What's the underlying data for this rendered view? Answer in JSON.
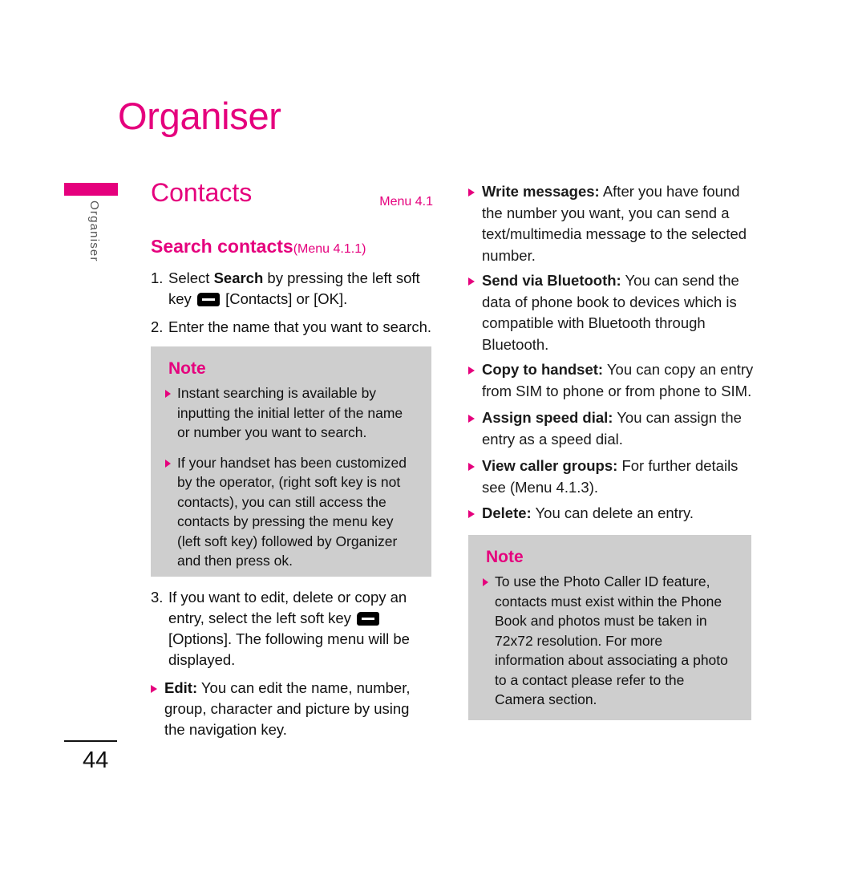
{
  "colors": {
    "accent": "#E5007D",
    "note_background": "#CECECE",
    "text": "#111111",
    "side_tab_text": "#555555"
  },
  "chapter": {
    "title": "Organiser",
    "side_tab_label": "Organiser"
  },
  "section": {
    "title": "Contacts",
    "menu_ref": "Menu 4.1"
  },
  "subsection": {
    "title": "Search contacts",
    "menu_ref": "(Menu 4.1.1)"
  },
  "left_column": {
    "steps": [
      {
        "number": "1.",
        "parts": [
          {
            "type": "text",
            "value": "Select "
          },
          {
            "type": "bold",
            "value": "Search"
          },
          {
            "type": "text",
            "value": " by pressing the left soft key "
          },
          {
            "type": "icon",
            "value": "soft-key-icon"
          },
          {
            "type": "text",
            "value": " [Contacts] or [OK]."
          }
        ],
        "plain": "1. Select Search by pressing the left soft key [Contacts] or [OK]."
      },
      {
        "number": "2.",
        "parts": [
          {
            "type": "text",
            "value": "Enter the name that you want to search."
          }
        ],
        "plain": "2. Enter the name that you want to search."
      },
      {
        "number": "3.",
        "parts": [
          {
            "type": "text",
            "value": "If you want to edit, delete or copy an entry, select the left soft key "
          },
          {
            "type": "icon",
            "value": "soft-key-icon"
          },
          {
            "type": "text",
            "value": " [Options]. The following menu will be displayed."
          }
        ],
        "plain": "3. If you want to edit, delete or copy an entry, select the left soft key [Options]. The following menu will be displayed."
      }
    ],
    "edit_bullet": {
      "label": "Edit:",
      "body": " You can edit the name, number, group, character and picture by using the navigation key."
    },
    "note": {
      "title": "Note",
      "bullets": [
        "Instant searching is available by inputting the initial letter of the name or number you want to search.",
        "If your handset has been customized by the operator, (right soft key is not contacts), you can still access the contacts by pressing the menu key (left soft key) followed by Organizer and then press ok."
      ]
    }
  },
  "right_column": {
    "options": [
      {
        "label": "Write messages:",
        "body": " After you have found the number you want, you can send a text/multimedia message to the selected number."
      },
      {
        "label": "Send via Bluetooth:",
        "body": " You can send the data of phone book to devices which is compatible with Bluetooth through Bluetooth."
      },
      {
        "label": "Copy to handset:",
        "body": " You can copy an entry from SIM to phone or from phone to SIM."
      },
      {
        "label": "Assign speed dial:",
        "body": " You can assign the entry as a speed dial."
      },
      {
        "label": "View caller groups:",
        "body": " For further details see (Menu 4.1.3)."
      },
      {
        "label": "Delete:",
        "body": " You can delete an entry."
      }
    ],
    "note": {
      "title": "Note",
      "bullets": [
        "To use the Photo Caller ID feature, contacts must exist within the Phone Book and photos must be taken in 72x72 resolution. For more information about associating a photo to a contact please refer to the Camera section."
      ]
    }
  },
  "footer": {
    "page_number": "44"
  }
}
